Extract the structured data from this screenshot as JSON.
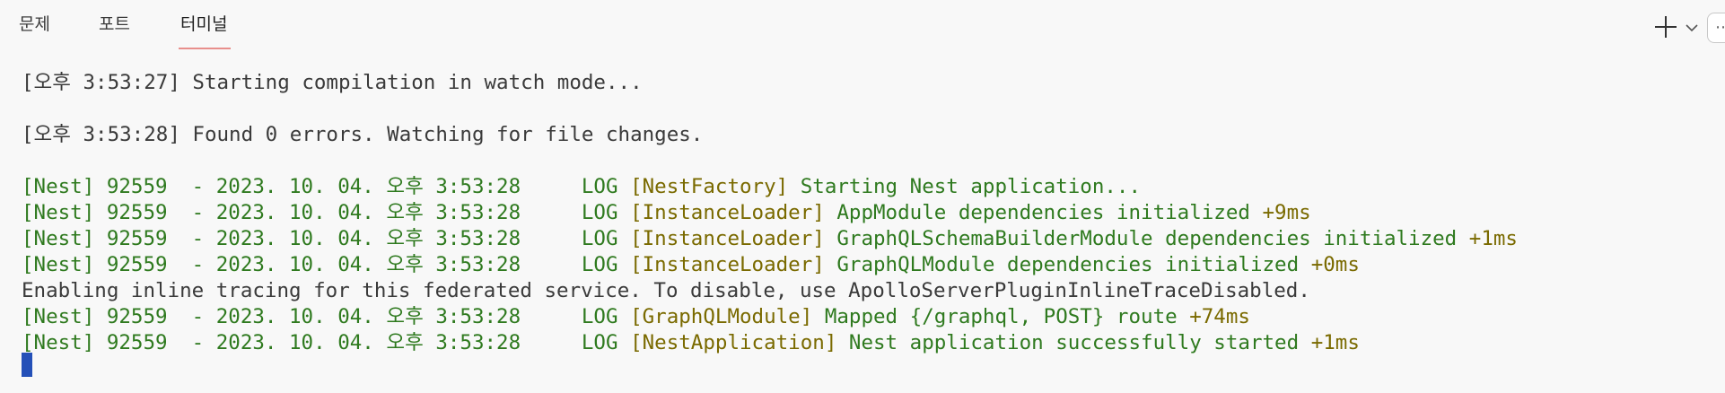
{
  "tabs": [
    {
      "label": "문제"
    },
    {
      "label": "포트"
    },
    {
      "label": "터미널",
      "active": true
    }
  ],
  "toolbar": {
    "add_icon": "plus-icon",
    "dropdown_icon": "chevron-down-icon",
    "more_label": "⋯"
  },
  "terminal": {
    "lines": [
      {
        "type": "plain",
        "text": "[오후 3:53:27] Starting compilation in watch mode..."
      },
      {
        "type": "blank",
        "text": ""
      },
      {
        "type": "plain",
        "text": "[오후 3:53:28] Found 0 errors. Watching for file changes."
      },
      {
        "type": "blank",
        "text": ""
      },
      {
        "type": "nest",
        "prefix": "[Nest] 92559  - 2023. 10. 04. 오후 3:53:28     LOG ",
        "context": "[NestFactory]",
        "message": " Starting Nest application..."
      },
      {
        "type": "nest",
        "prefix": "[Nest] 92559  - 2023. 10. 04. 오후 3:53:28     LOG ",
        "context": "[InstanceLoader]",
        "message": " AppModule dependencies initialized ",
        "timing": "+9ms"
      },
      {
        "type": "nest",
        "prefix": "[Nest] 92559  - 2023. 10. 04. 오후 3:53:28     LOG ",
        "context": "[InstanceLoader]",
        "message": " GraphQLSchemaBuilderModule dependencies initialized ",
        "timing": "+1ms"
      },
      {
        "type": "nest",
        "prefix": "[Nest] 92559  - 2023. 10. 04. 오후 3:53:28     LOG ",
        "context": "[InstanceLoader]",
        "message": " GraphQLModule dependencies initialized ",
        "timing": "+0ms"
      },
      {
        "type": "plain",
        "text": "Enabling inline tracing for this federated service. To disable, use ApolloServerPluginInlineTraceDisabled."
      },
      {
        "type": "nest",
        "prefix": "[Nest] 92559  - 2023. 10. 04. 오후 3:53:28     LOG ",
        "context": "[GraphQLModule]",
        "message": " Mapped {/graphql, POST} route ",
        "timing": "+74ms"
      },
      {
        "type": "nest",
        "prefix": "[Nest] 92559  - 2023. 10. 04. 오후 3:53:28     LOG ",
        "context": "[NestApplication]",
        "message": " Nest application successfully started ",
        "timing": "+1ms"
      }
    ]
  },
  "colors": {
    "nest_green": "#2f7a1f",
    "context_olive": "#7a6a00",
    "cursor_blue": "#2450b8",
    "tab_underline": "#e88f8c"
  }
}
